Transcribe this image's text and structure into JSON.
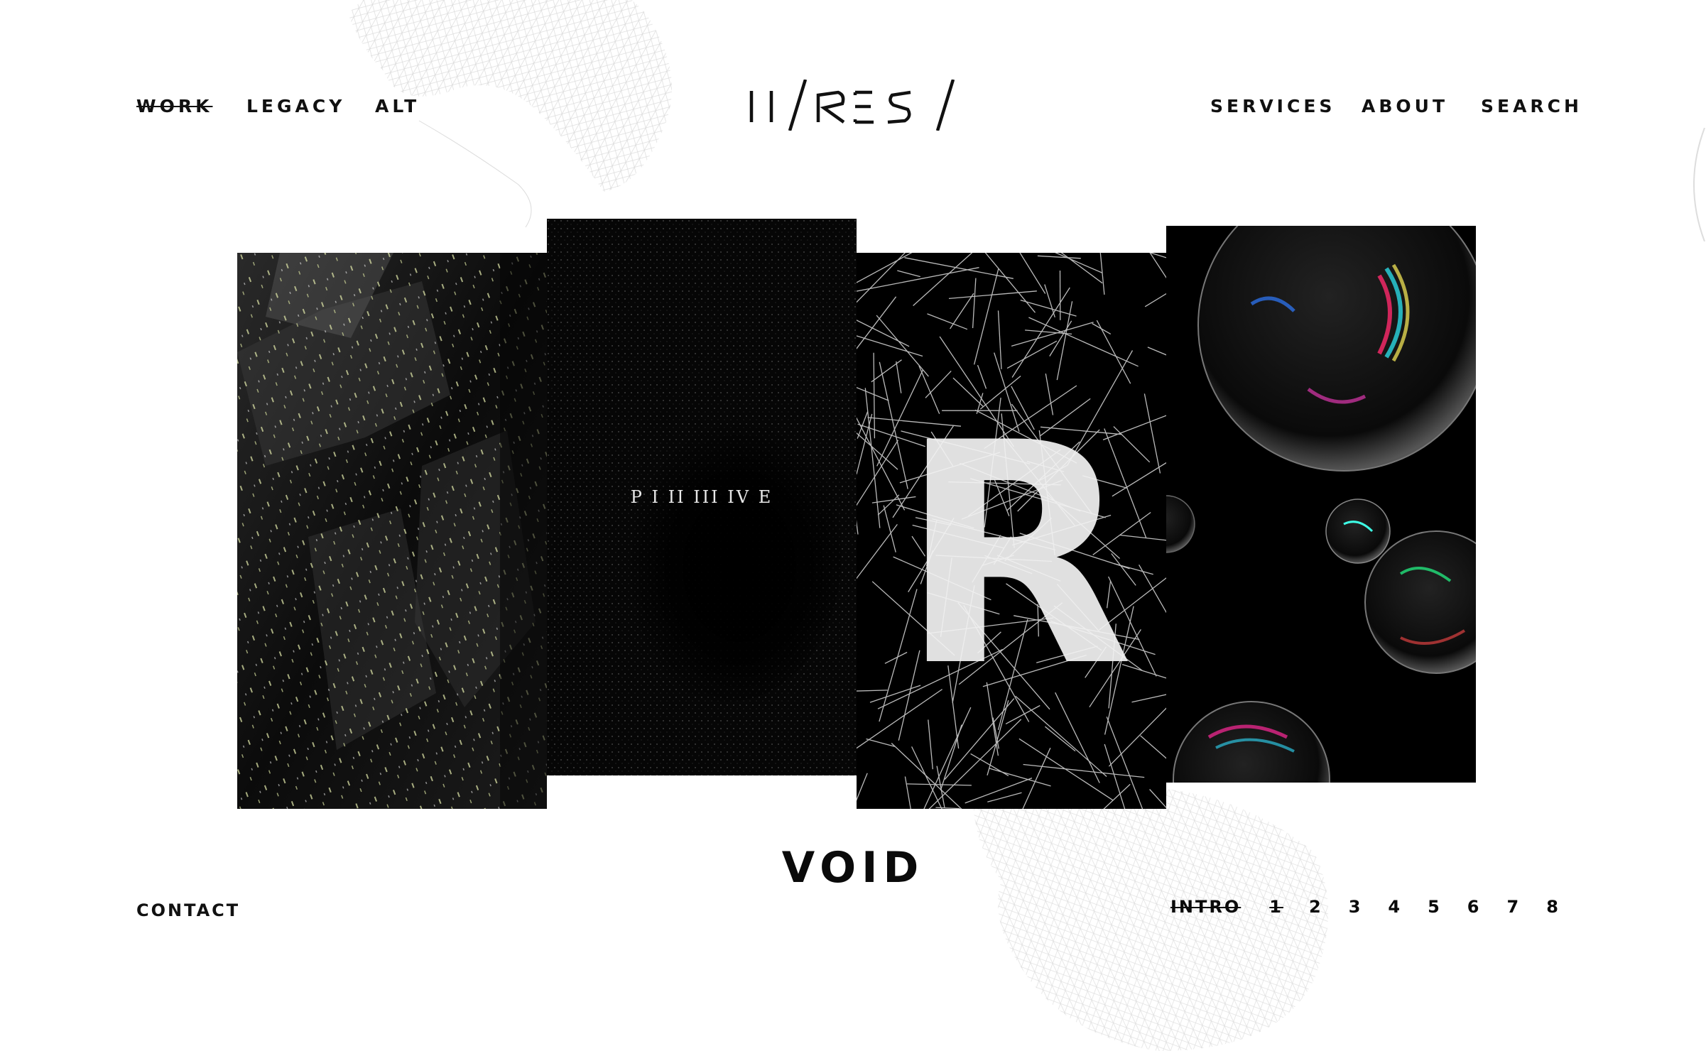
{
  "nav": {
    "left": [
      {
        "label": "WORK",
        "active": true
      },
      {
        "label": "LEGACY"
      },
      {
        "label": "ALT"
      }
    ],
    "right": [
      {
        "label": "SERVICES"
      },
      {
        "label": "ABOUT"
      },
      {
        "label": "SEARCH"
      }
    ],
    "logo_text": "HI/RES/"
  },
  "gallery": {
    "cards": [
      {
        "art": "dark-crystal-texture"
      },
      {
        "art": "particle-void",
        "caption": "P I II III IV E"
      },
      {
        "art": "shattered-lines-letter",
        "glyph": "R"
      },
      {
        "art": "chromatic-glass-spheres"
      }
    ],
    "title": "VOID"
  },
  "footer": {
    "contact_label": "CONTACT",
    "pager": {
      "intro_label": "INTRO",
      "pages": [
        "1",
        "2",
        "3",
        "4",
        "5",
        "6",
        "7",
        "8"
      ],
      "current_page": "1"
    }
  },
  "colors": {
    "text": "#0a0a0a",
    "background": "#ffffff",
    "card_bg": "#000000"
  }
}
